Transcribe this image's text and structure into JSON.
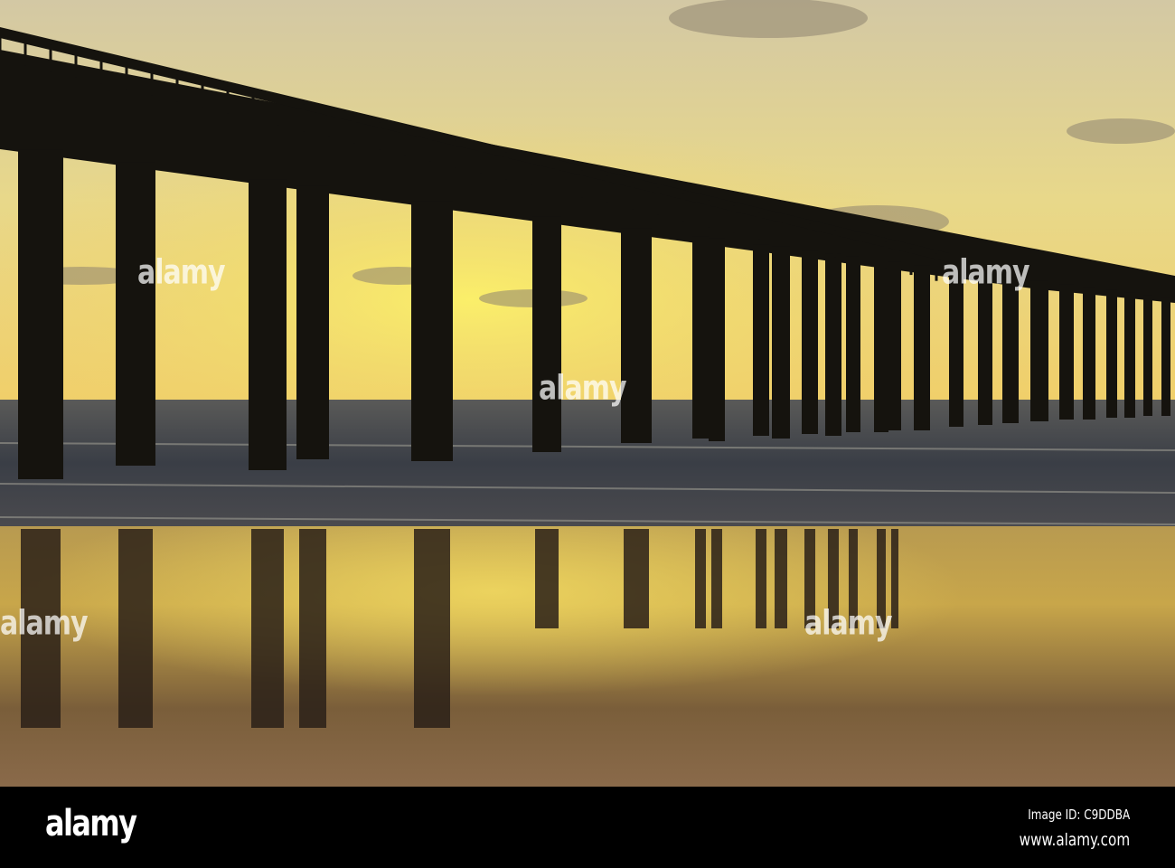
{
  "photo": {
    "subject": "pier-silhouette-sunset",
    "colors": {
      "sky_top": "#d9cc9c",
      "sun": "#f7e35a",
      "water": "#3b3f47",
      "sand": "#8a6a3a",
      "silhouette": "#16140f"
    }
  },
  "watermark": {
    "text": "alamy",
    "badge": "a"
  },
  "footer": {
    "logo": "alamy",
    "image_id": "Image ID: C9DDBA",
    "website": "www.alamy.com"
  }
}
